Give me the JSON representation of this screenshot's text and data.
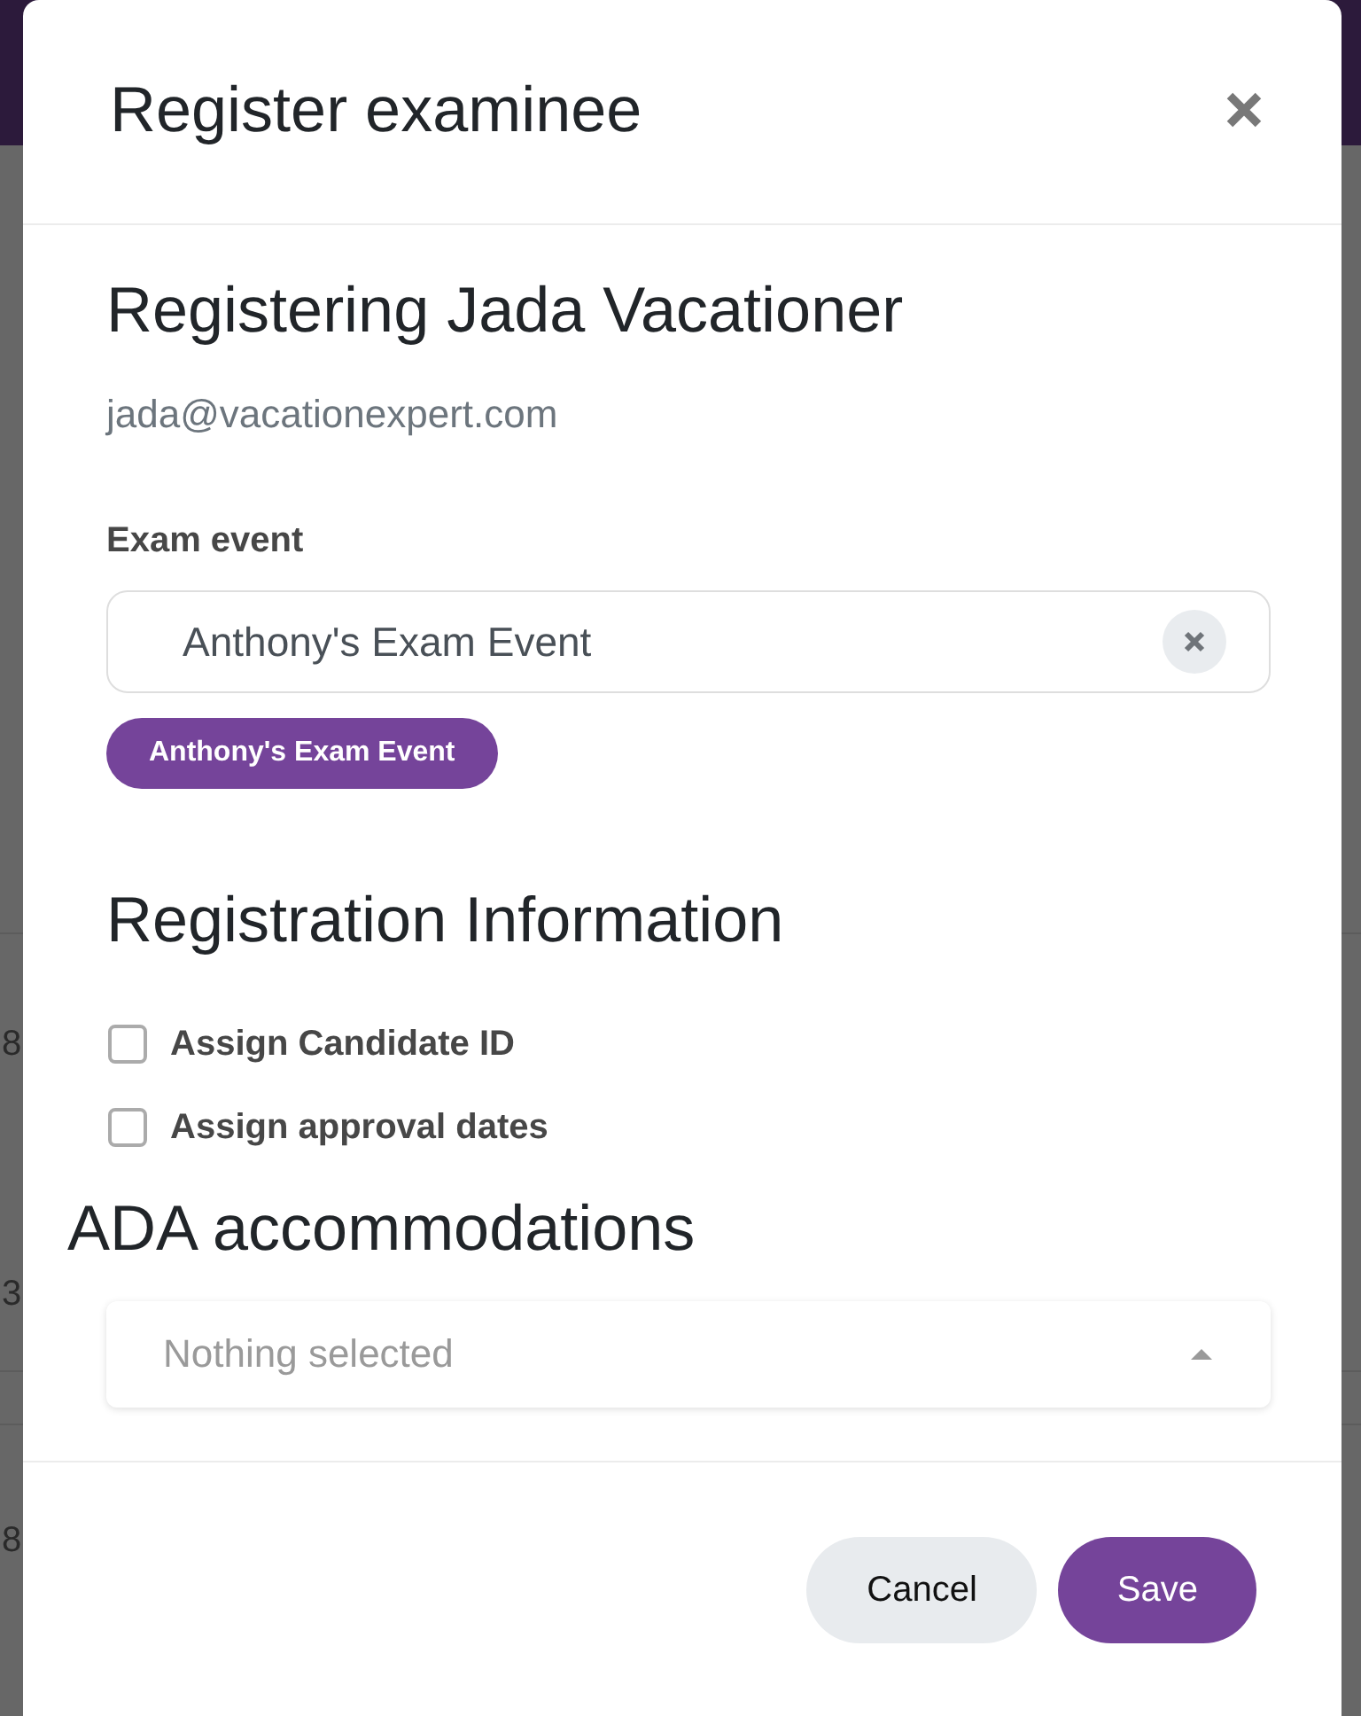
{
  "background": {
    "rows": [
      {
        "cell": "8"
      },
      {
        "cell": "3"
      },
      {
        "cell": "8"
      }
    ]
  },
  "dialog": {
    "title": "Register examinee",
    "subtitle": "Registering Jada Vacationer",
    "email": "jada@vacationexpert.com",
    "exam_event": {
      "label": "Exam event",
      "value": "Anthony's Exam Event",
      "chips": [
        {
          "label": "Anthony's Exam Event"
        }
      ]
    },
    "registration": {
      "heading": "Registration Information",
      "options": [
        {
          "label": "Assign Candidate ID",
          "checked": false
        },
        {
          "label": "Assign approval dates",
          "checked": false
        }
      ]
    },
    "ada": {
      "heading": "ADA accommodations",
      "placeholder": "Nothing selected"
    },
    "buttons": [
      {
        "label": "Cancel",
        "kind": "secondary"
      },
      {
        "label": "Save",
        "kind": "primary"
      }
    ]
  }
}
